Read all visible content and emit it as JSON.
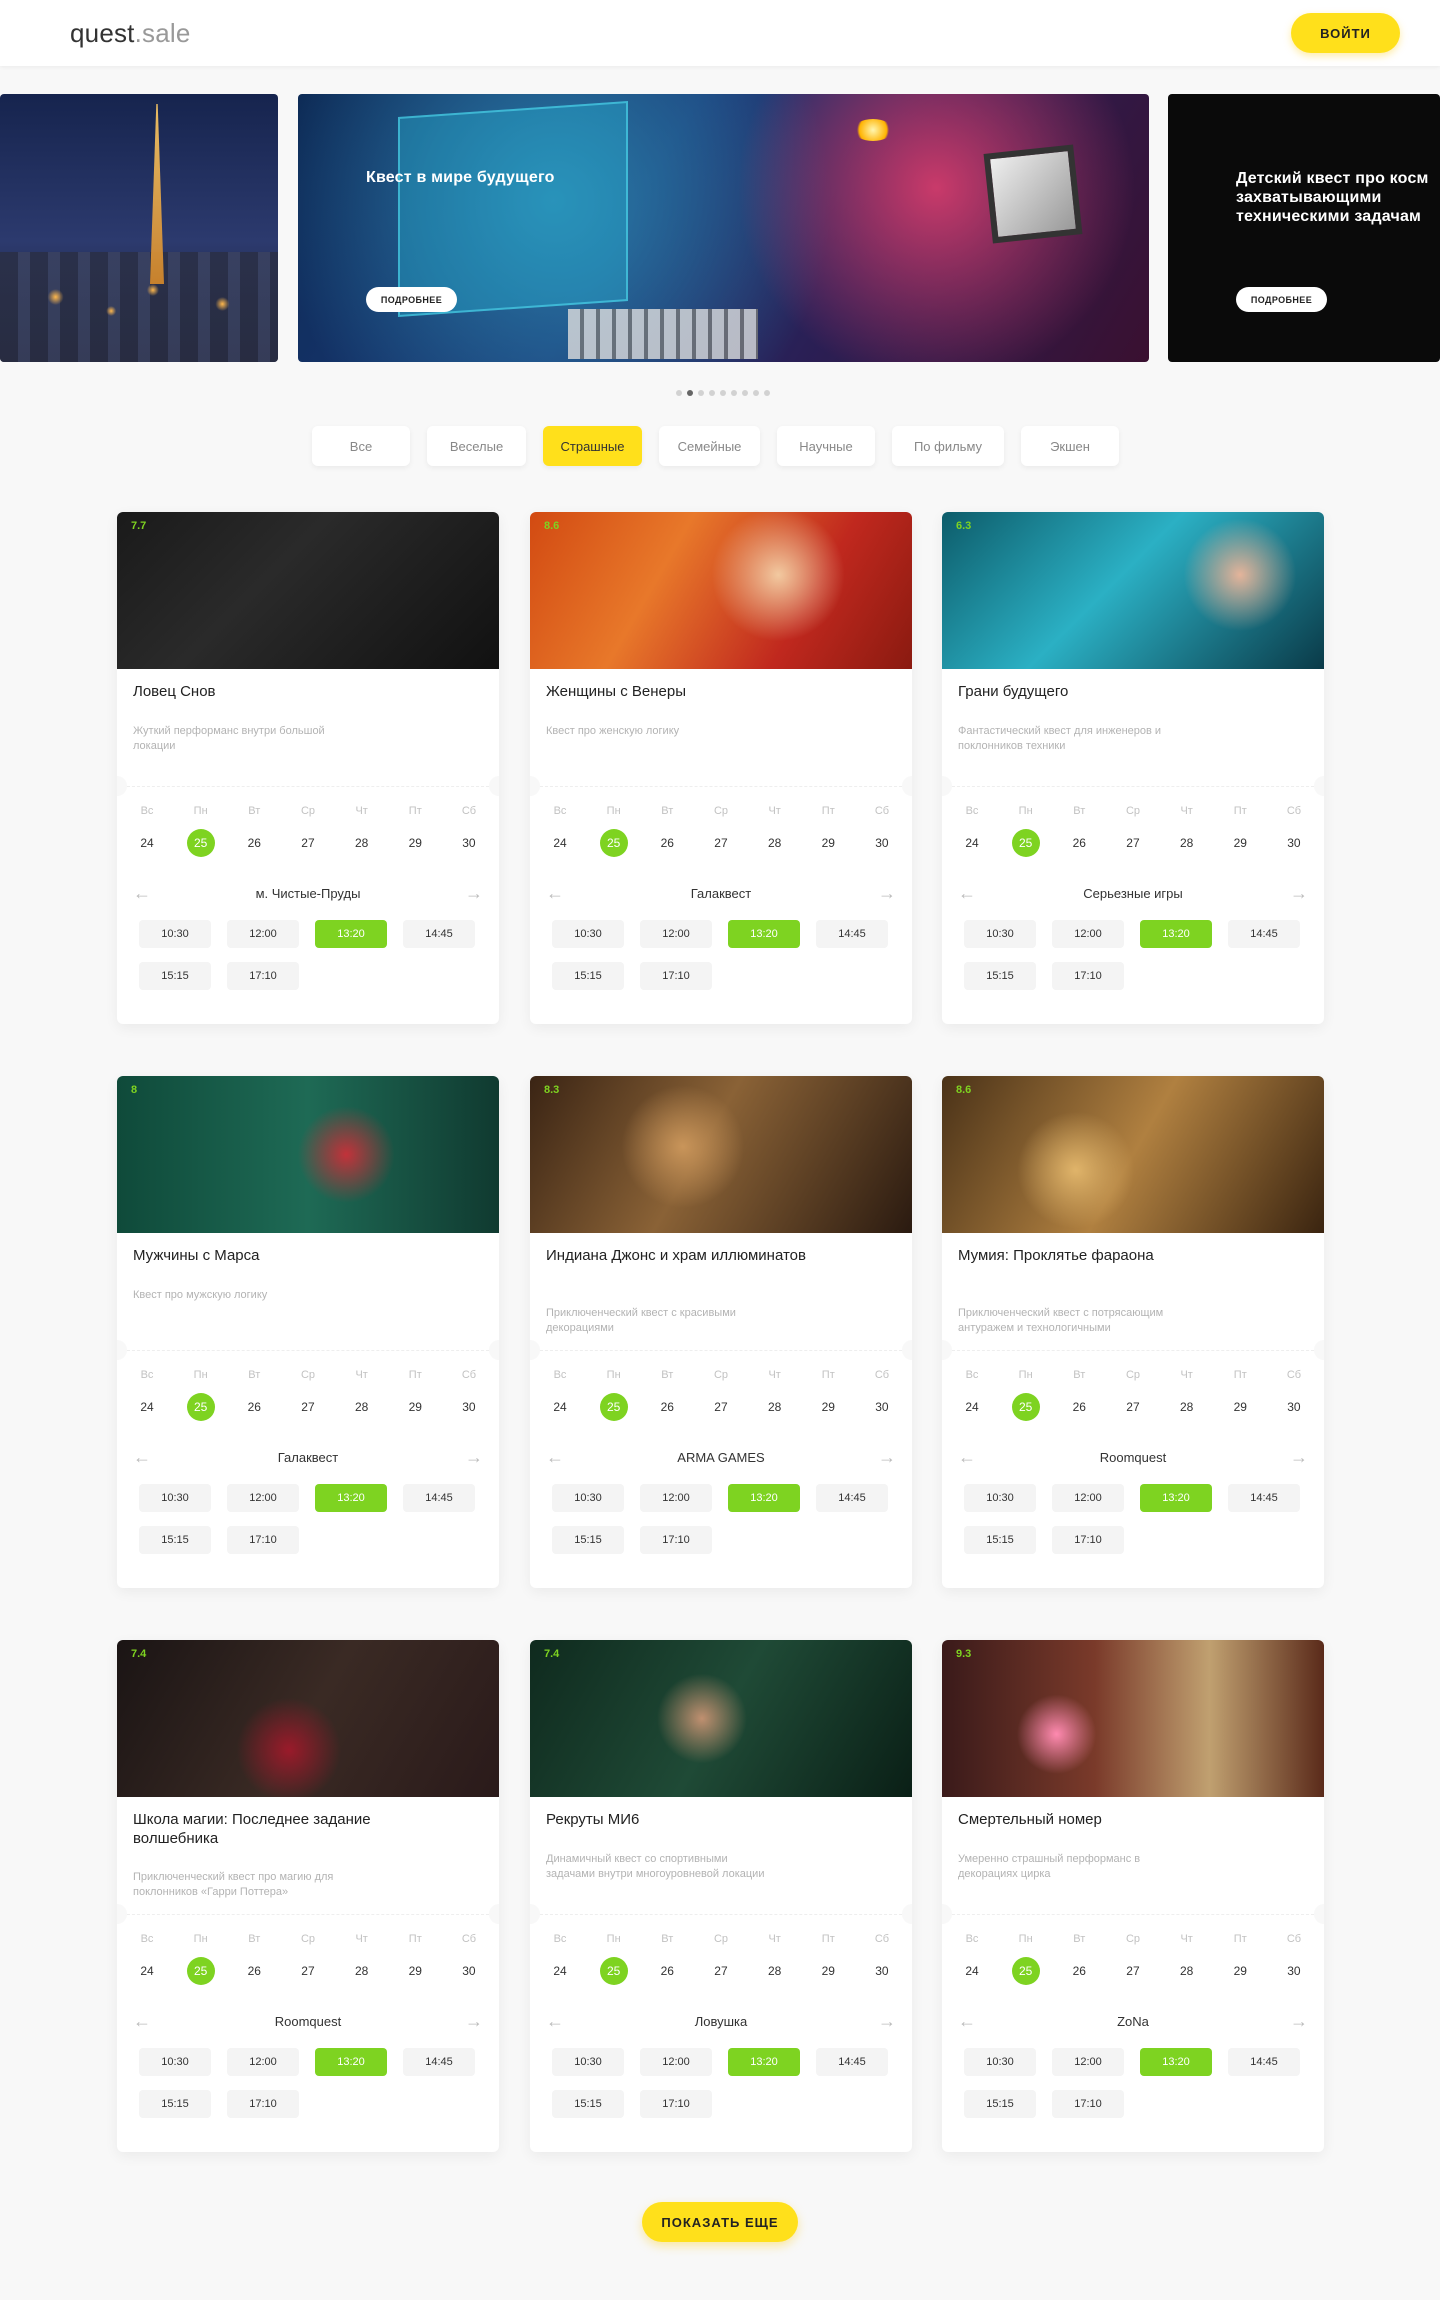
{
  "header": {
    "logo_main": "quest",
    "logo_sub": ".sale",
    "login": "ВОЙТИ"
  },
  "banners": [
    {
      "title": "Квест в мире будущего",
      "button": "ПОДРОБНЕЕ"
    },
    {
      "title": "Детский квест про косм...\nзахватывающими\nтехническими задачам",
      "button": "ПОДРОБНЕЕ"
    }
  ],
  "filters": [
    "Все",
    "Веселые",
    "Страшные",
    "Семейные",
    "Научные",
    "По фильму",
    "Экшен"
  ],
  "active_filter": "Страшные",
  "days": {
    "names": [
      "Вс",
      "Пн",
      "Вт",
      "Ср",
      "Чт",
      "Пт",
      "Сб"
    ],
    "nums": [
      "24",
      "25",
      "26",
      "27",
      "28",
      "29",
      "30"
    ]
  },
  "times": [
    "10:30",
    "12:00",
    "13:20",
    "14:45",
    "15:15",
    "17:10"
  ],
  "quests": [
    {
      "rating": "7.7",
      "title": "Ловец Снов",
      "desc": "Жуткий перформанс внутри большой локации",
      "location": "м. Чистые-Пруды"
    },
    {
      "rating": "8.6",
      "title": "Женщины с Венеры",
      "desc": "Квест про женскую логику",
      "location": "Галаквест"
    },
    {
      "rating": "6.3",
      "title": "Грани будущего",
      "desc": "Фантастический квест для инженеров и поклонников техники",
      "location": "Серьезные игры"
    },
    {
      "rating": "8",
      "title": "Мужчины с Марса",
      "desc": "Квест про мужскую логику",
      "location": "Галаквест"
    },
    {
      "rating": "8.3",
      "title": "Индиана Джонс и храм иллюминатов",
      "desc": "Приключенческий квест с красивыми декорациями",
      "location": "ARMA GAMES"
    },
    {
      "rating": "8.6",
      "title": "Мумия: Проклятье фараона",
      "desc": "Приключенческий квест с потрясающим антуражем и технологичными",
      "location": "Roomquest"
    },
    {
      "rating": "7.4",
      "title": "Школа магии: Последнее задание волшебника",
      "desc": "Приключенческий квест про магию для поклонников «Гарри Поттера»",
      "location": "Roomquest"
    },
    {
      "rating": "7.4",
      "title": "Рекруты МИ6",
      "desc": "Динамичный квест со спортивными задачами внутри многоуровневой локации",
      "location": "Ловушка"
    },
    {
      "rating": "9.3",
      "title": "Смертельный номер",
      "desc": "Умеренно страшный перформанс в декорациях цирка",
      "location": "ZoNa"
    }
  ],
  "show_more": "ПОКАЗАТЬ ЕЩЕ",
  "colors": {
    "accent": "#ffe01b",
    "green": "#7ed321"
  }
}
